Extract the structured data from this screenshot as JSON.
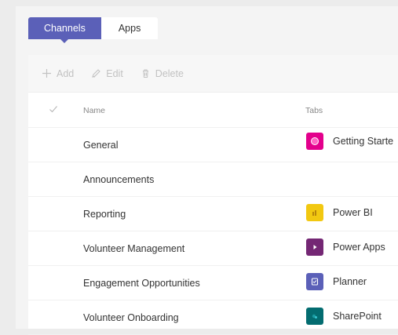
{
  "tabs": [
    {
      "label": "Channels",
      "active": true
    },
    {
      "label": "Apps",
      "active": false
    }
  ],
  "toolbar": {
    "add_label": "Add",
    "edit_label": "Edit",
    "delete_label": "Delete"
  },
  "table": {
    "columns": {
      "name": "Name",
      "tabs": "Tabs"
    },
    "rows": [
      {
        "name": "General",
        "tab": "Getting Starte",
        "tab_icon": "getting-started-app-icon",
        "tab_color": "#e3008c"
      },
      {
        "name": "Announcements",
        "tab": "",
        "tab_icon": "",
        "tab_color": ""
      },
      {
        "name": "Reporting",
        "tab": "Power BI",
        "tab_icon": "power-bi-app-icon",
        "tab_color": "#f2c811"
      },
      {
        "name": "Volunteer Management",
        "tab": "Power Apps",
        "tab_icon": "power-apps-app-icon",
        "tab_color": "#742774"
      },
      {
        "name": "Engagement Opportunities",
        "tab": "Planner",
        "tab_icon": "planner-app-icon",
        "tab_color": "#5b60b8"
      },
      {
        "name": "Volunteer Onboarding",
        "tab": "SharePoint",
        "tab_icon": "sharepoint-app-icon",
        "tab_color": "#036c70"
      }
    ]
  },
  "colors": {
    "accent": "#5b60b8",
    "disabled_text": "#c2c2c2"
  }
}
